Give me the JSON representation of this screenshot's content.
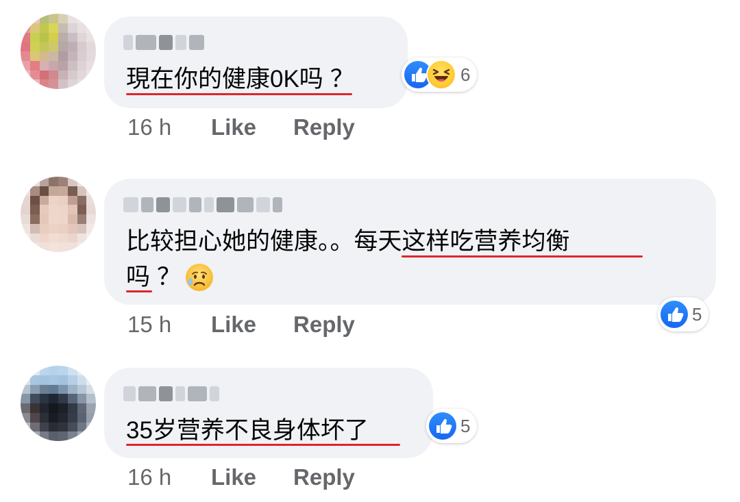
{
  "comments": [
    {
      "text_parts": [
        "現在你的健康0K吗",
        "？"
      ],
      "time": "16 h",
      "like_label": "Like",
      "reply_label": "Reply",
      "reactions": [
        "like",
        "haha"
      ],
      "reaction_count": "6"
    },
    {
      "line1_a": "比较担心她的健康。。",
      "line1_b": "每天这样吃营养均衡",
      "line2_a": "吗",
      "line2_b": "？",
      "time": "15 h",
      "like_label": "Like",
      "reply_label": "Reply",
      "reactions": [
        "like"
      ],
      "reaction_count": "5"
    },
    {
      "text": "35岁营养不良身体坏了",
      "time": "16 h",
      "like_label": "Like",
      "reply_label": "Reply",
      "reactions": [
        "like"
      ],
      "reaction_count": "5"
    }
  ],
  "icons": {
    "like": "like-reaction-icon",
    "haha": "haha-reaction-icon",
    "sad": "sad-tear-emoji"
  },
  "colors": {
    "bubble": "#f0f2f5",
    "underline": "#e0242b",
    "like_blue": "#1877f2",
    "meta_gray": "#65676b"
  }
}
